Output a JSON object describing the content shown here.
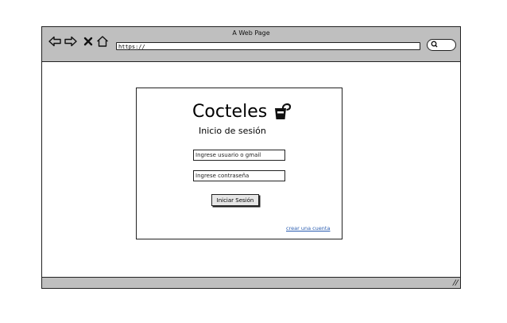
{
  "browser": {
    "title": "A Web Page",
    "url": "https://",
    "nav_icons": [
      "back-arrow-icon",
      "forward-arrow-icon",
      "close-icon",
      "home-icon"
    ],
    "search_icon": "search-icon"
  },
  "login": {
    "brand": "Cocteles",
    "brand_icon": "cup-icon",
    "subtitle": "Inicio de sesión",
    "user_placeholder": "Ingrese usuario o gmail",
    "password_placeholder": "Ingrese contraseña",
    "submit_label": "Iniciar Sesión",
    "create_account_label": "crear una cuenta"
  },
  "colors": {
    "chrome": "#bfbfbf",
    "link": "#2a5db0"
  }
}
